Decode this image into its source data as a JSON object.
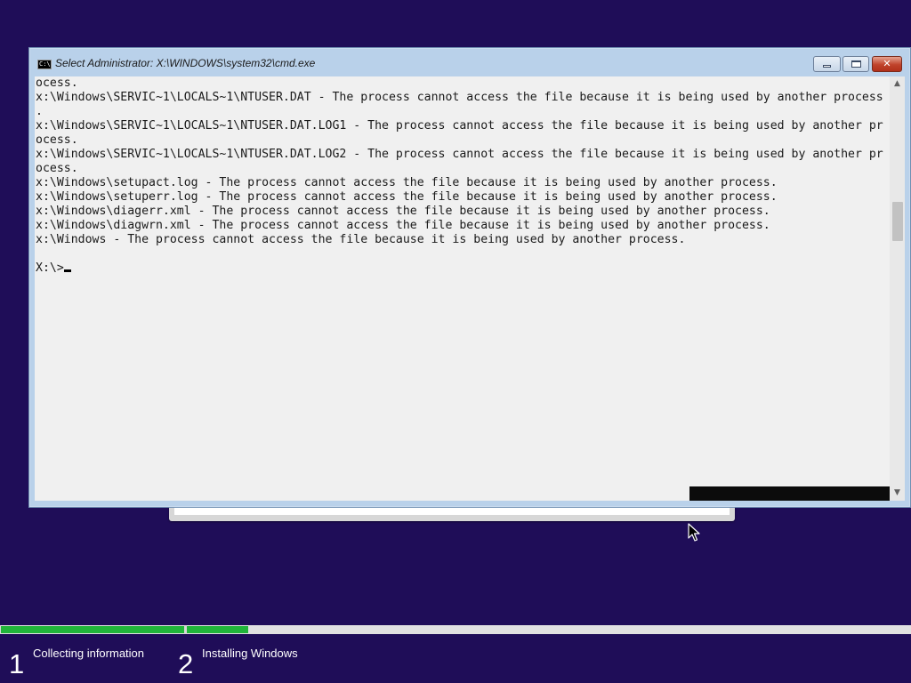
{
  "window": {
    "title": "Select Administrator: X:\\WINDOWS\\system32\\cmd.exe",
    "icon_label": "C:\\",
    "minimize_icon": "minimize-icon",
    "maximize_icon": "maximize-icon",
    "close_label": "✕"
  },
  "console": {
    "lines": [
      "ocess.",
      "x:\\Windows\\SERVIC~1\\LOCALS~1\\NTUSER.DAT - The process cannot access the file because it is being used by another process",
      ".",
      "x:\\Windows\\SERVIC~1\\LOCALS~1\\NTUSER.DAT.LOG1 - The process cannot access the file because it is being used by another pr",
      "ocess.",
      "x:\\Windows\\SERVIC~1\\LOCALS~1\\NTUSER.DAT.LOG2 - The process cannot access the file because it is being used by another pr",
      "ocess.",
      "x:\\Windows\\setupact.log - The process cannot access the file because it is being used by another process.",
      "x:\\Windows\\setuperr.log - The process cannot access the file because it is being used by another process.",
      "x:\\Windows\\diagerr.xml - The process cannot access the file because it is being used by another process.",
      "x:\\Windows\\diagwrn.xml - The process cannot access the file because it is being used by another process.",
      "x:\\Windows - The process cannot access the file because it is being used by another process.",
      ""
    ],
    "prompt": "X:\\>"
  },
  "scrollbar": {
    "up_arrow": "▲",
    "down_arrow": "▼"
  },
  "setup": {
    "steps": [
      {
        "number": "1",
        "label": "Collecting information",
        "progress": 1.0
      },
      {
        "number": "2",
        "label": "Installing Windows",
        "progress": 0.085
      }
    ]
  },
  "colors": {
    "desktop": "#1f0d58",
    "progress": "#21b53a",
    "console_bg": "#f0f0f0"
  }
}
